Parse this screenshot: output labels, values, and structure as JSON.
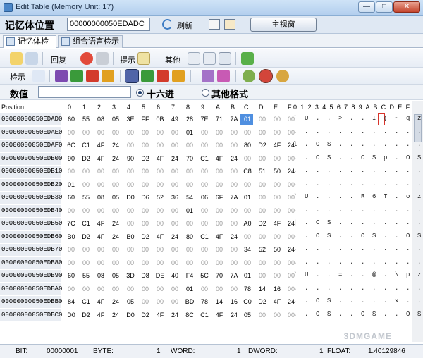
{
  "window": {
    "title": "Edit Table (Memory Unit: 17)",
    "buttons": [
      "—",
      "□",
      "✕"
    ]
  },
  "address_bar": {
    "label": "记忆体位置",
    "value": "00000000050EDADC",
    "refresh_label": "刷新",
    "main_view_label": "主视窗"
  },
  "tabs": [
    {
      "label": "记忆体检示",
      "active": true
    },
    {
      "label": "组合语言检示",
      "active": false
    }
  ],
  "toolbar1": {
    "back_label": "回复",
    "hint_label": "提示",
    "other_label": "其他"
  },
  "toolbar2": {
    "search_label": "检示"
  },
  "value_bar": {
    "label": "数值",
    "input_value": "",
    "radio_hex": "十六进",
    "radio_other": "其他格式",
    "selected": "hex"
  },
  "hex": {
    "position_header": "Position",
    "columns": [
      "0",
      "1",
      "2",
      "3",
      "4",
      "5",
      "6",
      "7",
      "8",
      "9",
      "A",
      "B",
      "C",
      "D",
      "E",
      "F"
    ],
    "ascii_header": "0 1 2 3 4 5 6 7 8 9 A B C D E F",
    "rows": [
      {
        "addr": "00000000050EDAD0",
        "bytes": [
          "60",
          "55",
          "08",
          "05",
          "3E",
          "FF",
          "0B",
          "49",
          "28",
          "7E",
          "71",
          "7A",
          "01",
          "00",
          "00",
          "00"
        ],
        "ascii": "` U . . > . . I ( ~ q z . . . ."
      },
      {
        "addr": "00000000050EDAE0",
        "bytes": [
          "00",
          "00",
          "00",
          "00",
          "00",
          "00",
          "00",
          "00",
          "01",
          "00",
          "00",
          "00",
          "00",
          "00",
          "00",
          "00"
        ],
        "ascii": ". . . . . . . . . . . . . . . ."
      },
      {
        "addr": "00000000050EDAF0",
        "bytes": [
          "6C",
          "C1",
          "4F",
          "24",
          "00",
          "00",
          "00",
          "00",
          "00",
          "00",
          "00",
          "00",
          "80",
          "D2",
          "4F",
          "24"
        ],
        "ascii": "l . O $ . . . . . . . . . . O $"
      },
      {
        "addr": "00000000050EDB00",
        "bytes": [
          "90",
          "D2",
          "4F",
          "24",
          "90",
          "D2",
          "4F",
          "24",
          "70",
          "C1",
          "4F",
          "24",
          "00",
          "00",
          "00",
          "00"
        ],
        "ascii": ". . O $ . . O $ p . O $ . . . ."
      },
      {
        "addr": "00000000050EDB10",
        "bytes": [
          "00",
          "00",
          "00",
          "00",
          "00",
          "00",
          "00",
          "00",
          "00",
          "00",
          "00",
          "00",
          "C8",
          "51",
          "50",
          "24"
        ],
        "ascii": ". . . . . . . . . . . . . Q P $"
      },
      {
        "addr": "00000000050EDB20",
        "bytes": [
          "01",
          "00",
          "00",
          "00",
          "00",
          "00",
          "00",
          "00",
          "00",
          "00",
          "00",
          "00",
          "00",
          "00",
          "00",
          "00"
        ],
        "ascii": ". . . . . . . . . . . . . . . ."
      },
      {
        "addr": "00000000050EDB30",
        "bytes": [
          "60",
          "55",
          "08",
          "05",
          "D0",
          "D6",
          "52",
          "36",
          "54",
          "06",
          "6F",
          "7A",
          "01",
          "00",
          "00",
          "00"
        ],
        "ascii": "` U . . . . R 6 T . o z . . . ."
      },
      {
        "addr": "00000000050EDB40",
        "bytes": [
          "00",
          "00",
          "00",
          "00",
          "00",
          "00",
          "00",
          "00",
          "01",
          "00",
          "00",
          "00",
          "00",
          "00",
          "00",
          "00"
        ],
        "ascii": ". . . . . . . . . . . . . . . ."
      },
      {
        "addr": "00000000050EDB50",
        "bytes": [
          "7C",
          "C1",
          "4F",
          "24",
          "00",
          "00",
          "00",
          "00",
          "00",
          "00",
          "00",
          "00",
          "A0",
          "D2",
          "4F",
          "24"
        ],
        "ascii": "| . O $ . . . . . . . . . . O $"
      },
      {
        "addr": "00000000050EDB60",
        "bytes": [
          "B0",
          "D2",
          "4F",
          "24",
          "B0",
          "D2",
          "4F",
          "24",
          "80",
          "C1",
          "4F",
          "24",
          "00",
          "00",
          "00",
          "00"
        ],
        "ascii": ". . O $ . . O $ . . O $ . . . ."
      },
      {
        "addr": "00000000050EDB70",
        "bytes": [
          "00",
          "00",
          "00",
          "00",
          "00",
          "00",
          "00",
          "00",
          "00",
          "00",
          "00",
          "00",
          "34",
          "52",
          "50",
          "24"
        ],
        "ascii": ". . . . . . . . . . . . 4 R P $"
      },
      {
        "addr": "00000000050EDB80",
        "bytes": [
          "00",
          "00",
          "00",
          "00",
          "00",
          "00",
          "00",
          "00",
          "00",
          "00",
          "00",
          "00",
          "00",
          "00",
          "00",
          "00"
        ],
        "ascii": ". . . . . . . . . . . . . . . ."
      },
      {
        "addr": "00000000050EDB90",
        "bytes": [
          "60",
          "55",
          "08",
          "05",
          "3D",
          "D8",
          "DE",
          "40",
          "F4",
          "5C",
          "70",
          "7A",
          "01",
          "00",
          "00",
          "00"
        ],
        "ascii": "` U . . = . . @ . \\ p z . . . ."
      },
      {
        "addr": "00000000050EDBA0",
        "bytes": [
          "00",
          "00",
          "00",
          "00",
          "00",
          "00",
          "00",
          "00",
          "01",
          "00",
          "00",
          "00",
          "78",
          "14",
          "16",
          "00"
        ],
        "ascii": ". . . . . . . . . . . . x . . ."
      },
      {
        "addr": "00000000050EDBB0",
        "bytes": [
          "84",
          "C1",
          "4F",
          "24",
          "05",
          "00",
          "00",
          "00",
          "BD",
          "78",
          "14",
          "16",
          "C0",
          "D2",
          "4F",
          "24"
        ],
        "ascii": ". . O $ . . . . . x . . . . O $"
      },
      {
        "addr": "00000000050EDBC0",
        "bytes": [
          "D0",
          "D2",
          "4F",
          "24",
          "D0",
          "D2",
          "4F",
          "24",
          "8C",
          "C1",
          "4F",
          "24",
          "05",
          "00",
          "00",
          "00"
        ],
        "ascii": ". . O $ . . O $ . . O $ . . . ."
      }
    ]
  },
  "status_bar": {
    "bit_label": "BIT:",
    "bit_value": "00000001",
    "byte_label": "BYTE:",
    "byte_value": "1",
    "word_label": "WORD:",
    "word_value": "1",
    "dword_label": "DWORD:",
    "dword_value": "1",
    "float_label": "FLOAT:",
    "float_value": "1.40129846"
  },
  "watermark": "3DMGAME",
  "colors": {
    "cursor": "#4f8fe0",
    "cursor_ascii_border": "#d8342b",
    "address_column_bg": "#e9edf3"
  }
}
